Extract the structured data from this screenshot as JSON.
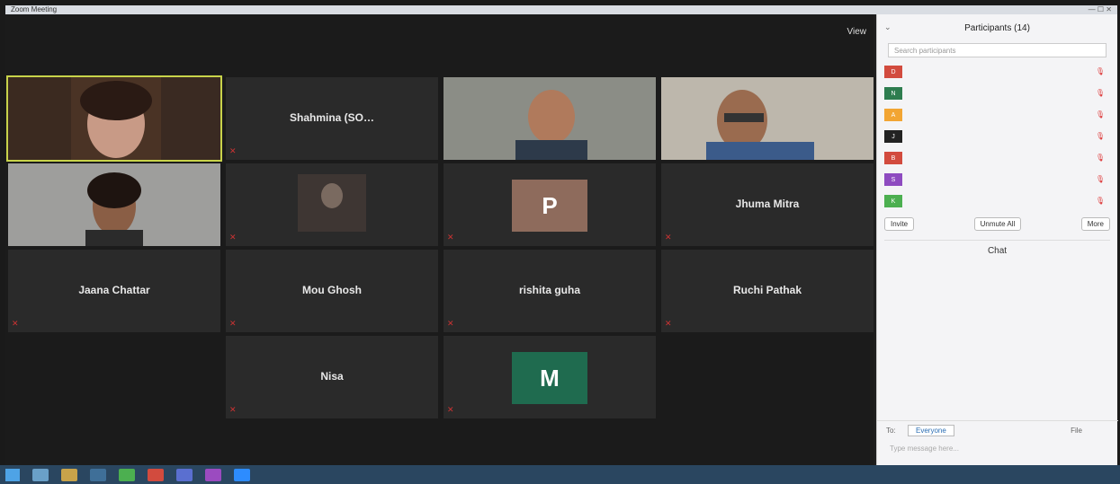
{
  "window": {
    "title": "Zoom Meeting",
    "controls": "— ☐ ✕"
  },
  "toolbar": {
    "view_label": "View"
  },
  "tiles": [
    {
      "label": ""
    },
    {
      "center_name": "Shahmina (SO…"
    },
    {
      "label": ""
    },
    {
      "label": ""
    },
    {
      "label": ""
    },
    {
      "label": ""
    },
    {
      "avatar_letter": "P",
      "label": ""
    },
    {
      "center_name": "Jhuma Mitra"
    },
    {
      "center_name": "Jaana Chattar"
    },
    {
      "center_name": "Mou Ghosh"
    },
    {
      "center_name": "rishita guha"
    },
    {
      "center_name": "Ruchi Pathak"
    },
    {
      "center_name": "Nisa"
    },
    {
      "avatar_letter": "M",
      "label": ""
    }
  ],
  "sidebar": {
    "title": "Participants (14)",
    "search_placeholder": "Search participants",
    "participants": [
      {
        "initial": "D",
        "name": "",
        "color": "#d24b3e"
      },
      {
        "initial": "N",
        "name": "",
        "color": "#2e7d4f"
      },
      {
        "initial": "A",
        "name": "",
        "color": "#f2a533"
      },
      {
        "initial": "J",
        "name": "",
        "color": "#222222"
      },
      {
        "initial": "B",
        "name": "",
        "color": "#d24b3e"
      },
      {
        "initial": "S",
        "name": "",
        "color": "#8e4bc0"
      },
      {
        "initial": "K",
        "name": "",
        "color": "#4caf50"
      }
    ],
    "buttons": {
      "invite": "Invite",
      "mute_all": "Unmute All",
      "more": "More"
    },
    "chat_title": "Chat",
    "chat_footer": {
      "to": "To:",
      "to_select": "Everyone",
      "file": "File",
      "placeholder": "Type message here..."
    }
  },
  "taskbar": {
    "clock": ""
  }
}
